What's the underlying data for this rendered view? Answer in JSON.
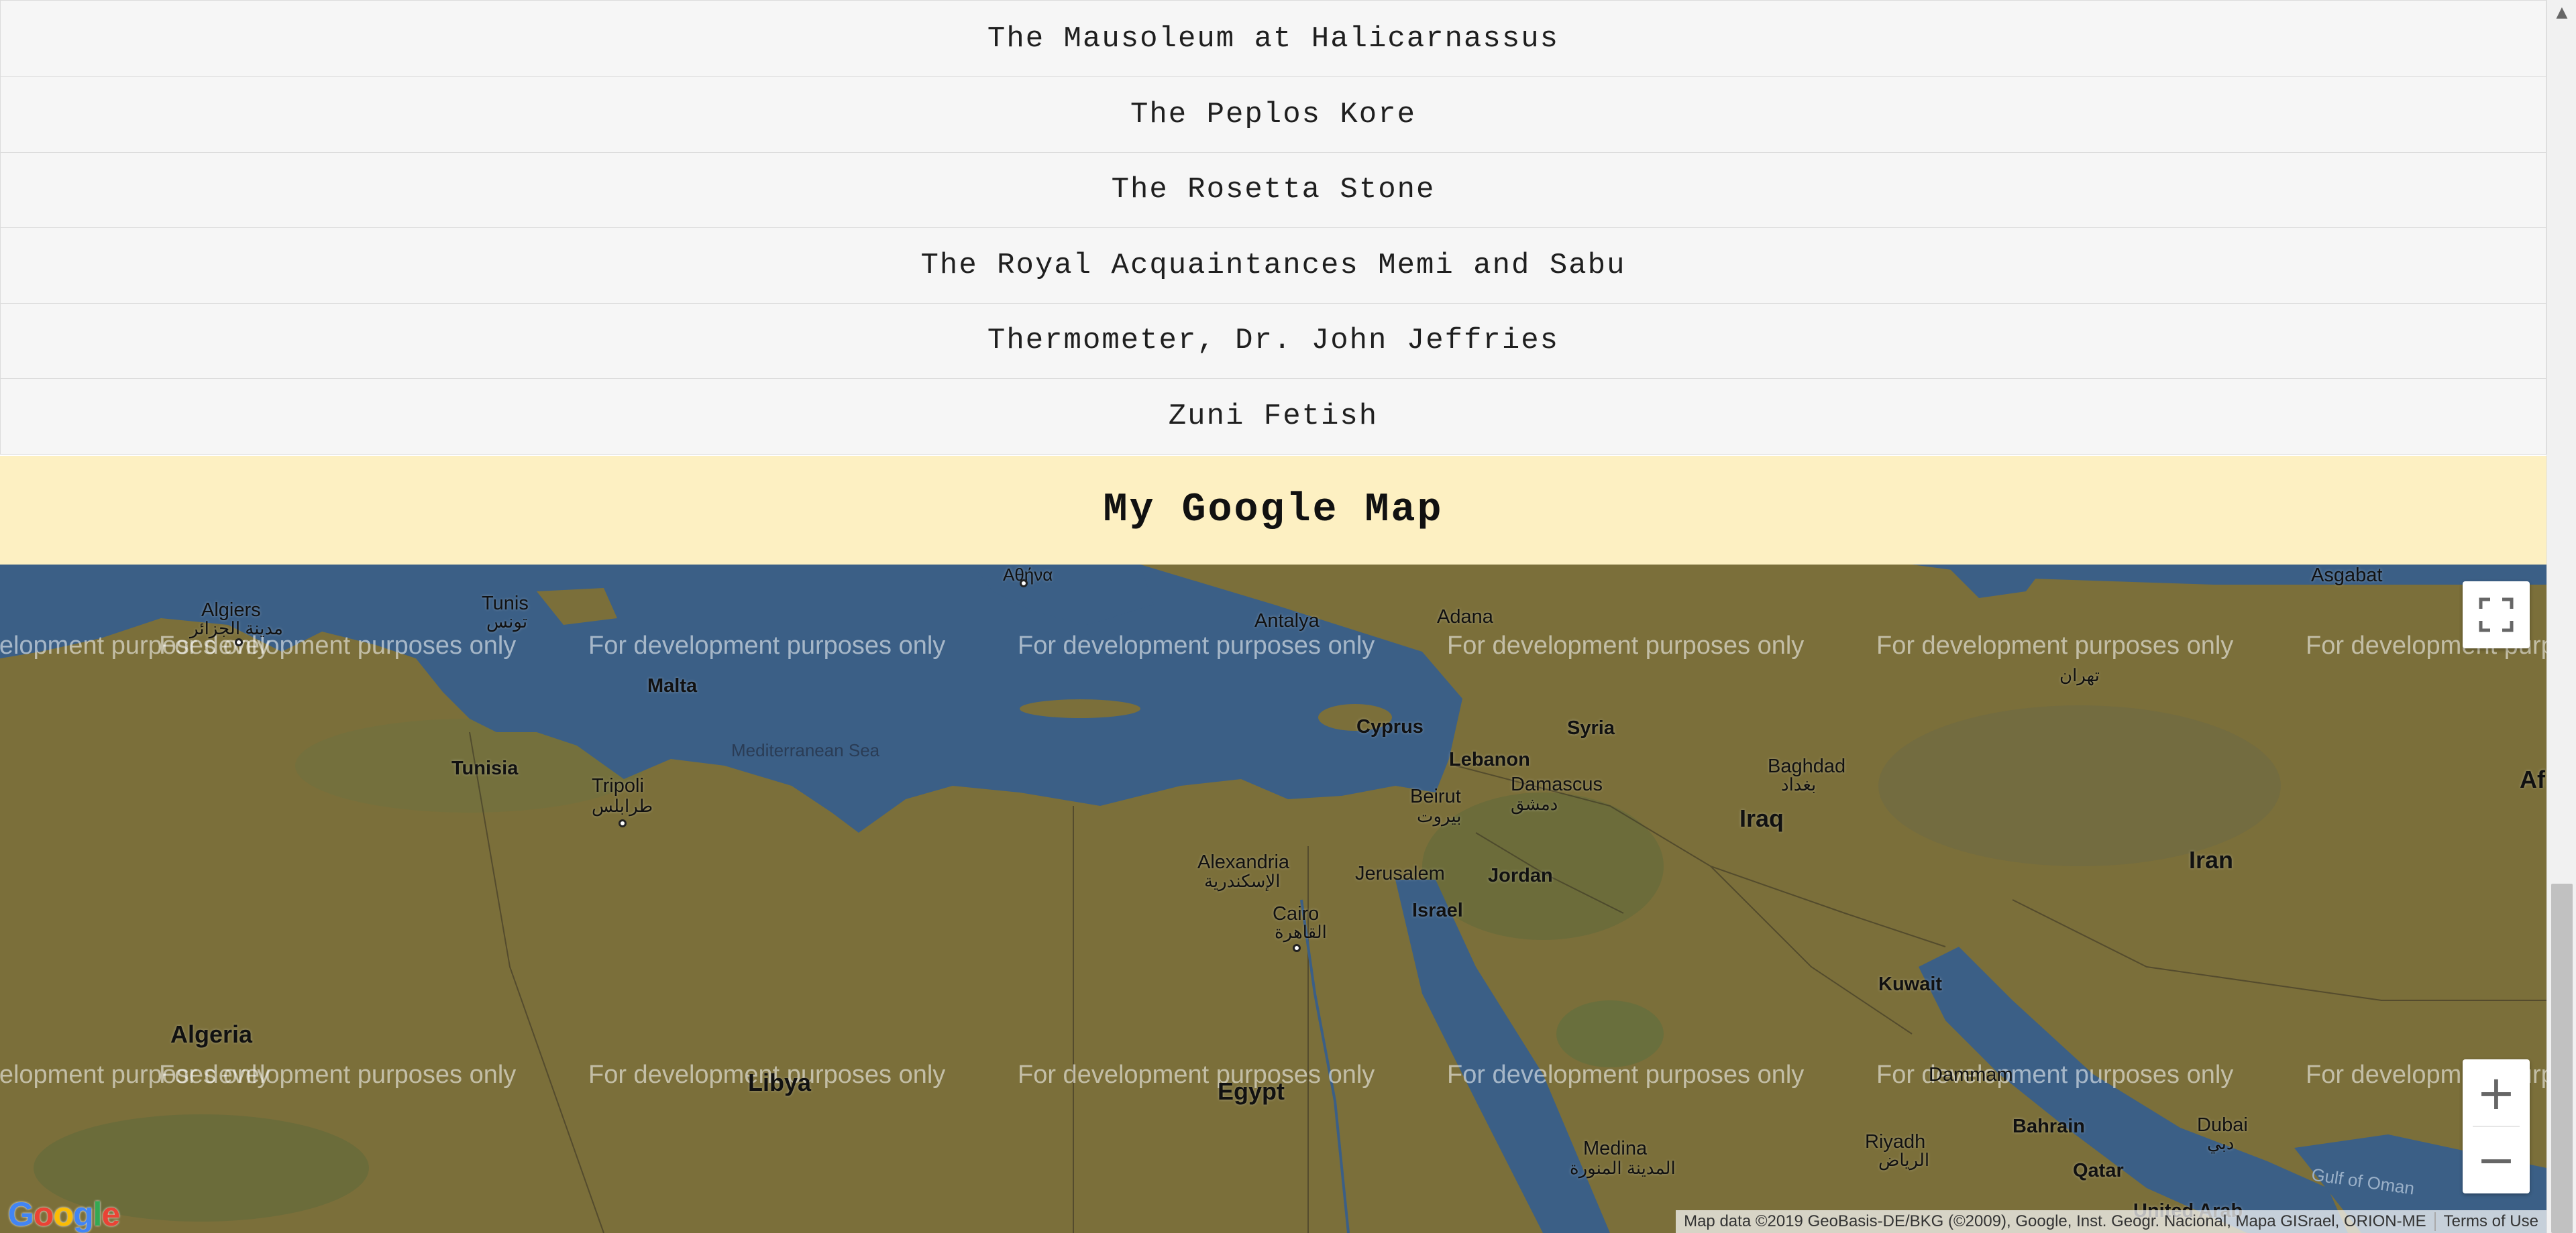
{
  "artifacts": {
    "items": [
      {
        "label": "The Mausoleum at Halicarnassus"
      },
      {
        "label": "The Peplos Kore"
      },
      {
        "label": "The Rosetta Stone"
      },
      {
        "label": "The Royal Acquaintances Memi and Sabu"
      },
      {
        "label": "Thermometer, Dr. John Jeffries"
      },
      {
        "label": "Zuni Fetish"
      }
    ]
  },
  "map_section": {
    "title": "My Google Map"
  },
  "map": {
    "watermark": "For development purposes only",
    "labels": {
      "algiers": "Algiers",
      "algiers_ar": "مدينة الجزائر",
      "tunis": "Tunis",
      "tunis_ar": "تونس",
      "malta": "Malta",
      "tunisia": "Tunisia",
      "tripoli": "Tripoli",
      "tripoli_ar": "طرابلس",
      "mediterranean_sea": "Mediterranean Sea",
      "athens_ar": "Αθήνα",
      "antalya": "Antalya",
      "adana": "Adana",
      "cyprus": "Cyprus",
      "syria": "Syria",
      "lebanon": "Lebanon",
      "damascus": "Damascus",
      "damascus_ar": "دمشق",
      "beirut": "Beirut",
      "beirut_ar": "بيروت",
      "baghdad": "Baghdad",
      "baghdad_ar": "بغداد",
      "iraq": "Iraq",
      "tehran_ar": "تهران",
      "ashgabat": "Asgabat",
      "iran": "Iran",
      "af": "Af",
      "alexandria": "Alexandria",
      "alexandria_ar": "الإسكندرية",
      "jerusalem": "Jerusalem",
      "jordan": "Jordan",
      "israel": "Israel",
      "cairo": "Cairo",
      "cairo_ar": "القاهرة",
      "kuwait": "Kuwait",
      "algeria": "Algeria",
      "libya": "Libya",
      "egypt": "Egypt",
      "dammam": "Dammam",
      "bahrain": "Bahrain",
      "riyadh": "Riyadh",
      "riyadh_ar": "الرياض",
      "qatar": "Qatar",
      "dubai": "Dubai",
      "dubai_ar": "دبي",
      "medina": "Medina",
      "medina_ar": "المدينة المنورة",
      "gulf_of_oman": "Gulf of Oman",
      "united_arab": "United Arab"
    },
    "logo": "Google",
    "attribution": "Map data ©2019 GeoBasis-DE/BKG (©2009), Google, Inst. Geogr. Nacional, Mapa GISrael, ORION-ME",
    "terms": "Terms of Use",
    "colors": {
      "water": "#3b5f86",
      "land": "#7b6f3a",
      "land_dark": "#5e6a3a",
      "header_bg": "#fdf0c2",
      "list_bg": "#f6f6f6"
    }
  },
  "controls": {
    "fullscreen_icon": "fullscreen-icon",
    "zoom_in_symbol": "+",
    "zoom_out_symbol": "−"
  },
  "scrollbar": {
    "up_arrow": "▲"
  }
}
